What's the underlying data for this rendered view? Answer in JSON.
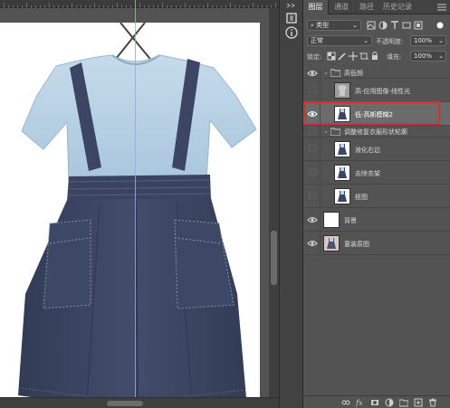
{
  "tabs": [
    "图层",
    "通道",
    "路径",
    "历史记录"
  ],
  "filter": {
    "value": "类型"
  },
  "blend_mode": {
    "value": "正常"
  },
  "opacity": {
    "label": "不透明度:",
    "value": "100%"
  },
  "lock": {
    "label": "锁定:"
  },
  "fill": {
    "label": "填充:",
    "value": "100%"
  },
  "layers": [
    {
      "name": "高低频",
      "kind": "group",
      "visible": true,
      "expanded": true
    },
    {
      "name": "高-应用图像-线性光",
      "kind": "layer",
      "visible": false,
      "thumb": "shirt"
    },
    {
      "name": "低-高斯模糊2",
      "kind": "layer",
      "visible": true,
      "thumb": "dress-dark",
      "selected": true
    },
    {
      "name": "调整修复衣服形状轮廓",
      "kind": "group",
      "visible": false,
      "expanded": true
    },
    {
      "name": "液化右边",
      "kind": "layer",
      "visible": false,
      "thumb": "dress"
    },
    {
      "name": "去除衣架",
      "kind": "layer",
      "visible": false,
      "thumb": "dress"
    },
    {
      "name": "抠图",
      "kind": "layer",
      "visible": false,
      "thumb": "dress"
    },
    {
      "name": "背景",
      "kind": "layer",
      "visible": true,
      "thumb": "white"
    },
    {
      "name": "童装原图",
      "kind": "layer",
      "visible": true,
      "thumb": "photo"
    }
  ],
  "colors": {
    "selection_highlight": "#d23232",
    "guide": "#5ac8e0",
    "dress_navy": "#3c4664",
    "shirt_blue": "#b9d3e6"
  },
  "icons": {
    "strip": [
      "toggle-panels-icon",
      "history-icon",
      "info-icon"
    ],
    "bottom": [
      "link-icon",
      "fx-icon",
      "mask-icon",
      "adjustment-icon",
      "folder-icon",
      "new-layer-icon",
      "trash-icon"
    ]
  }
}
